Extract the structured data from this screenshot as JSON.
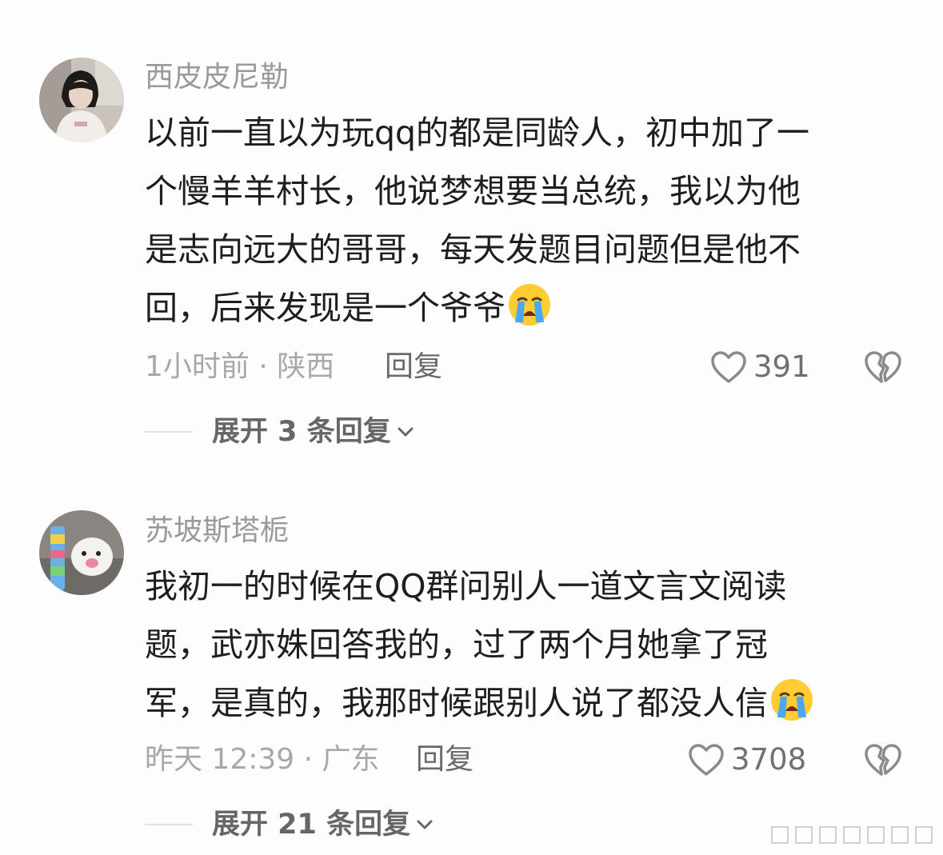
{
  "comments": [
    {
      "username": "西皮皮尼勒",
      "lines": [
        "以前一直以为玩qq的都是同龄人，初中加了一",
        "个慢羊羊村长，他说梦想要当总统，我以为他",
        "是志向远大的哥哥，每天发题目问题但是他不",
        "回，后来发现是一个爷爷"
      ],
      "emoji": "loudly-crying-face",
      "time_location": "1小时前 · 陕西",
      "reply_label": "回复",
      "like_count": "391",
      "expand_label": "展开 3 条回复"
    },
    {
      "username": "苏坡斯塔栀",
      "lines": [
        "我初一的时候在QQ群问别人一道文言文阅读",
        "题，武亦姝回答我的，过了两个月她拿了冠",
        "军，是真的，我那时候跟别人说了都没人信"
      ],
      "emoji": "loudly-crying-face",
      "time_location": "昨天 12:39 · 广东",
      "reply_label": "回复",
      "like_count": "3708",
      "expand_label": "展开 21 条回复"
    }
  ],
  "icons": {
    "like": "heart-outline-icon",
    "dislike": "broken-heart-icon",
    "expand": "chevron-down-icon"
  },
  "colors": {
    "background": "#fdfdfd",
    "username": "#9a9a9a",
    "text": "#1e1e1e",
    "meta": "#a8a8a8",
    "icon": "#8a8a8a"
  }
}
